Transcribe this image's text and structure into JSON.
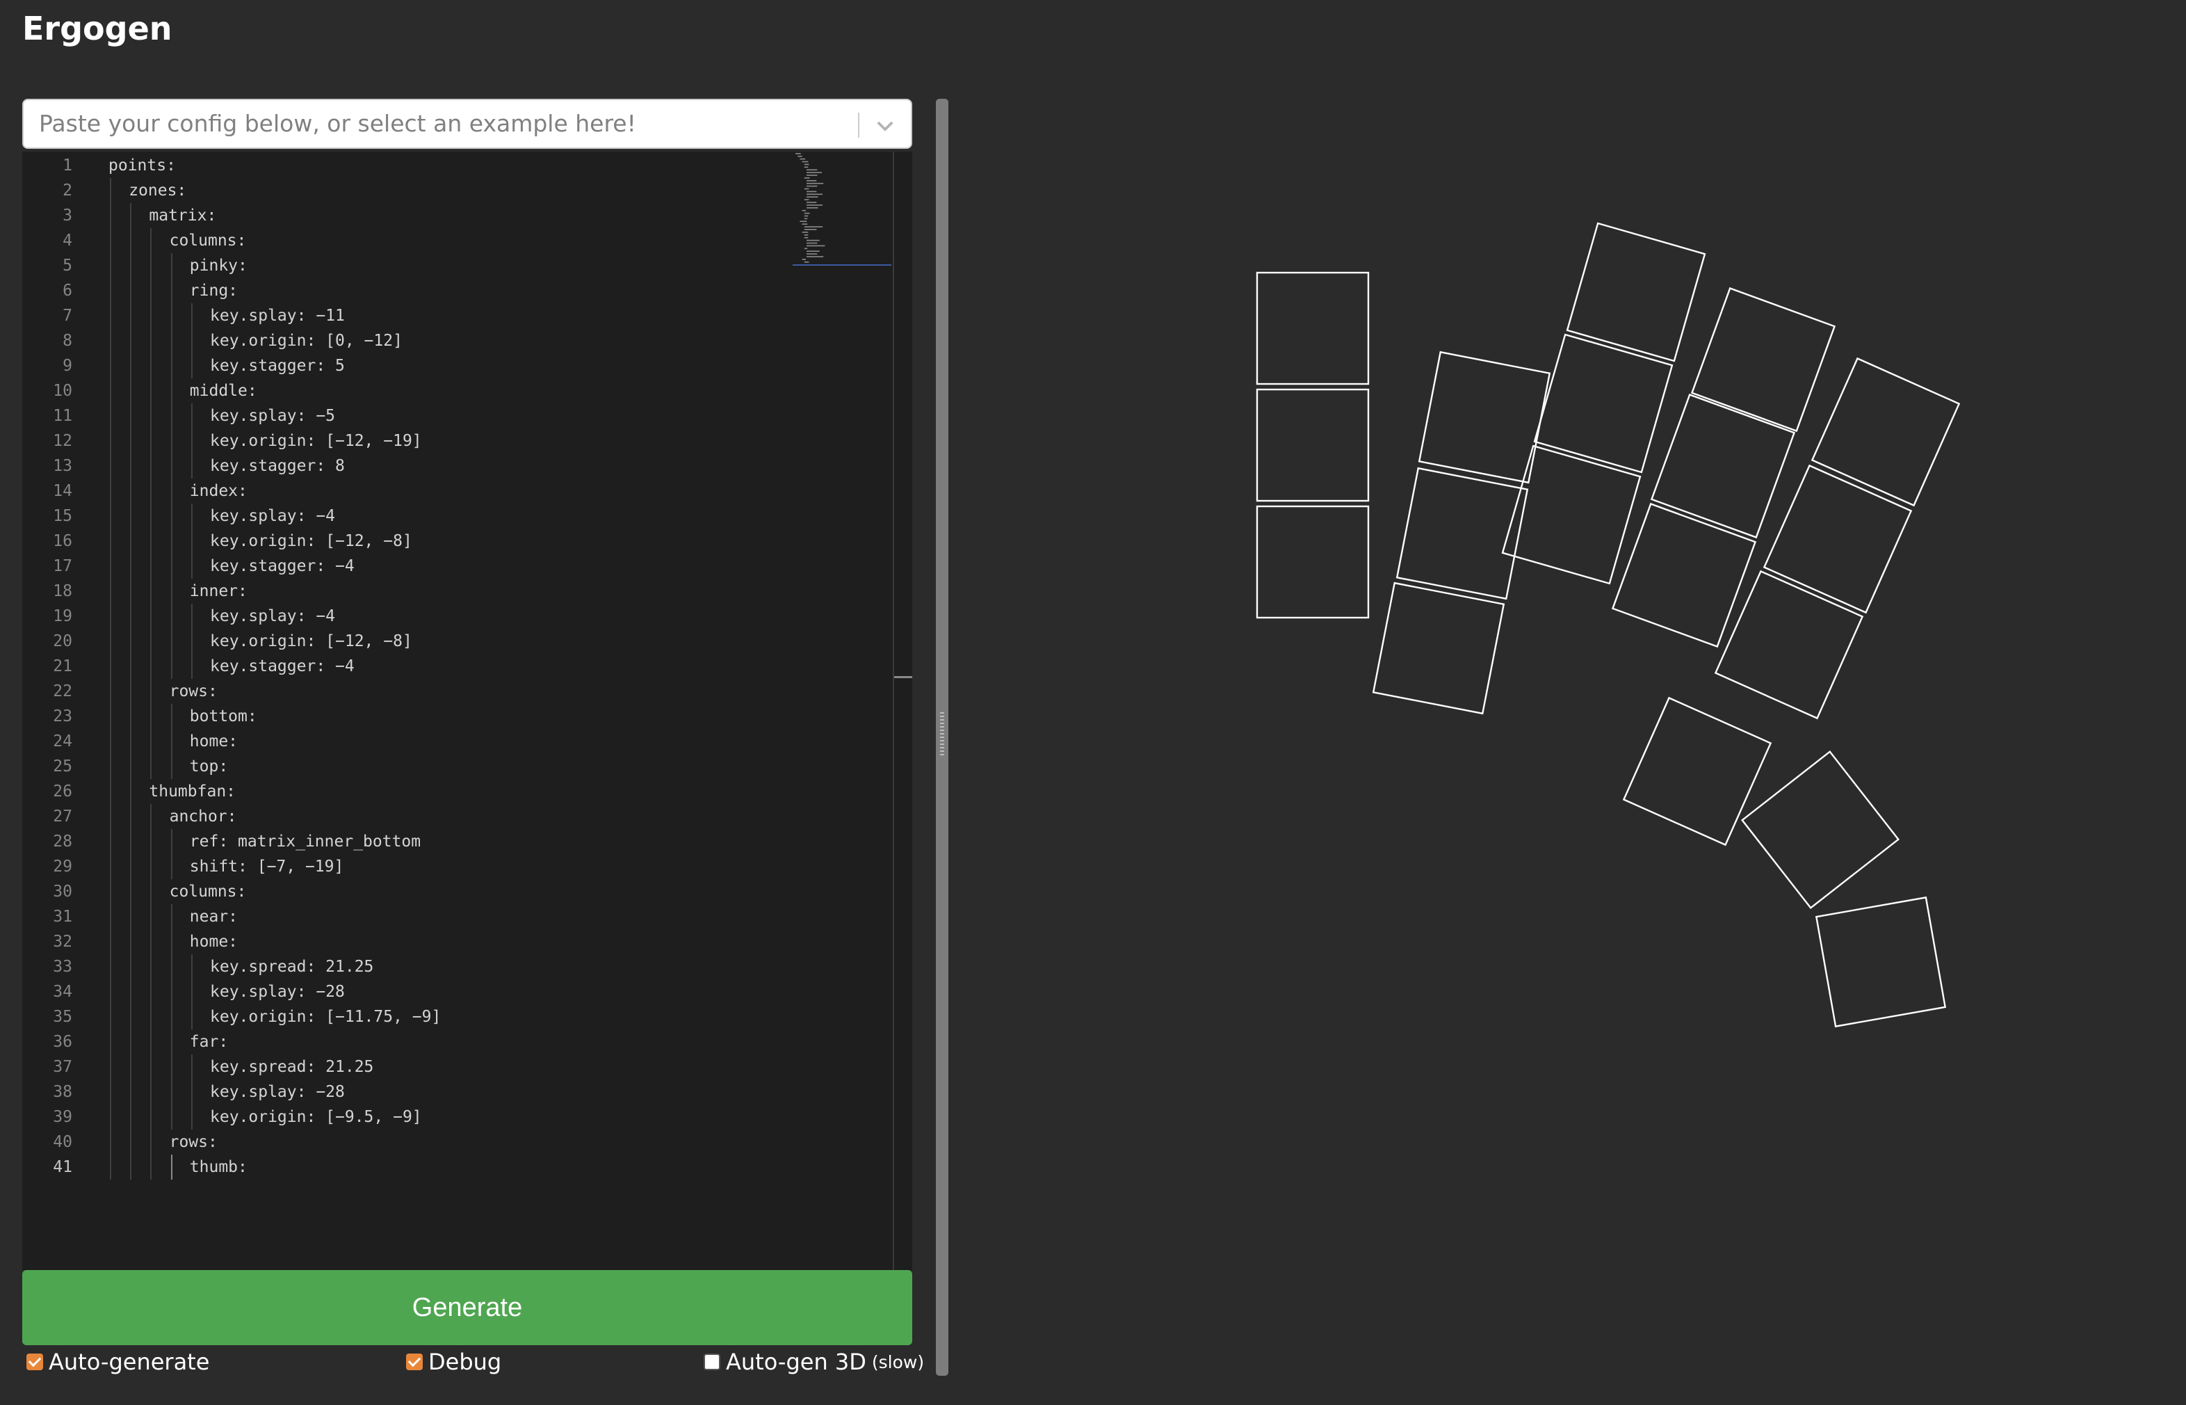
{
  "app": {
    "title": "Ergogen"
  },
  "config_select": {
    "placeholder": "Paste your config below, or select an example here!"
  },
  "editor": {
    "active_line": 41,
    "lines": [
      {
        "n": "1",
        "text": "points:",
        "indent": 0
      },
      {
        "n": "2",
        "text": "zones:",
        "indent": 1
      },
      {
        "n": "3",
        "text": "matrix:",
        "indent": 2
      },
      {
        "n": "4",
        "text": "columns:",
        "indent": 3
      },
      {
        "n": "5",
        "text": "pinky:",
        "indent": 4
      },
      {
        "n": "6",
        "text": "ring:",
        "indent": 4
      },
      {
        "n": "7",
        "text": "key.splay: −11",
        "indent": 5
      },
      {
        "n": "8",
        "text": "key.origin: [0, −12]",
        "indent": 5
      },
      {
        "n": "9",
        "text": "key.stagger: 5",
        "indent": 5
      },
      {
        "n": "10",
        "text": "middle:",
        "indent": 4
      },
      {
        "n": "11",
        "text": "key.splay: −5",
        "indent": 5
      },
      {
        "n": "12",
        "text": "key.origin: [−12, −19]",
        "indent": 5
      },
      {
        "n": "13",
        "text": "key.stagger: 8",
        "indent": 5
      },
      {
        "n": "14",
        "text": "index:",
        "indent": 4
      },
      {
        "n": "15",
        "text": "key.splay: −4",
        "indent": 5
      },
      {
        "n": "16",
        "text": "key.origin: [−12, −8]",
        "indent": 5
      },
      {
        "n": "17",
        "text": "key.stagger: −4",
        "indent": 5
      },
      {
        "n": "18",
        "text": "inner:",
        "indent": 4
      },
      {
        "n": "19",
        "text": "key.splay: −4",
        "indent": 5
      },
      {
        "n": "20",
        "text": "key.origin: [−12, −8]",
        "indent": 5
      },
      {
        "n": "21",
        "text": "key.stagger: −4",
        "indent": 5
      },
      {
        "n": "22",
        "text": "rows:",
        "indent": 3
      },
      {
        "n": "23",
        "text": "bottom:",
        "indent": 4
      },
      {
        "n": "24",
        "text": "home:",
        "indent": 4
      },
      {
        "n": "25",
        "text": "top:",
        "indent": 4
      },
      {
        "n": "26",
        "text": "thumbfan:",
        "indent": 2
      },
      {
        "n": "27",
        "text": "anchor:",
        "indent": 3
      },
      {
        "n": "28",
        "text": "ref: matrix_inner_bottom",
        "indent": 4
      },
      {
        "n": "29",
        "text": "shift: [−7, −19]",
        "indent": 4
      },
      {
        "n": "30",
        "text": "columns:",
        "indent": 3
      },
      {
        "n": "31",
        "text": "near:",
        "indent": 4
      },
      {
        "n": "32",
        "text": "home:",
        "indent": 4
      },
      {
        "n": "33",
        "text": "key.spread: 21.25",
        "indent": 5
      },
      {
        "n": "34",
        "text": "key.splay: −28",
        "indent": 5
      },
      {
        "n": "35",
        "text": "key.origin: [−11.75, −9]",
        "indent": 5
      },
      {
        "n": "36",
        "text": "far:",
        "indent": 4
      },
      {
        "n": "37",
        "text": "key.spread: 21.25",
        "indent": 5
      },
      {
        "n": "38",
        "text": "key.splay: −28",
        "indent": 5
      },
      {
        "n": "39",
        "text": "key.origin: [−9.5, −9]",
        "indent": 5
      },
      {
        "n": "40",
        "text": "rows:",
        "indent": 3
      },
      {
        "n": "41",
        "text": "thumb:",
        "indent": 4
      }
    ]
  },
  "generate_button": {
    "label": "Generate"
  },
  "options": [
    {
      "label": "Auto-generate",
      "note": "",
      "checked": true
    },
    {
      "label": "Debug",
      "note": "",
      "checked": true
    },
    {
      "label": "Auto-gen 3D",
      "note": "(slow)",
      "checked": false
    }
  ],
  "colors": {
    "accent": "#4fa651",
    "checkbox": "#e8873a",
    "background": "#2b2b2b",
    "editor_bg": "#1e1e1e"
  }
}
